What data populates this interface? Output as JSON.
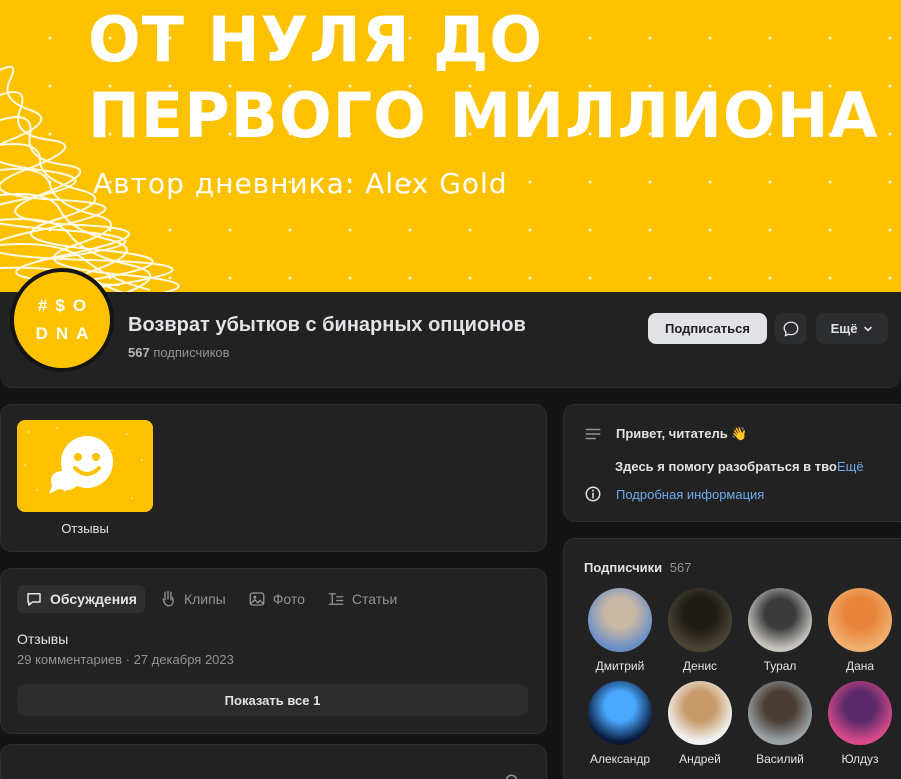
{
  "cover": {
    "title_line1": "ОТ НУЛЯ ДО",
    "title_line2": "ПЕРВОГО МИЛЛИОНА",
    "subtitle": "Автор дневника: Alex Gold",
    "color": "#fcc200"
  },
  "group": {
    "avatar_line1": "#$O",
    "avatar_line2": "DNA",
    "name": "Возврат убытков с бинарных опционов",
    "subscriber_count": "567",
    "subscriber_label": "подписчиков"
  },
  "actions": {
    "subscribe_label": "Подписаться",
    "message_icon": "message-bubble-icon",
    "more_label": "Ещё"
  },
  "album": {
    "label": "Отзывы",
    "icon": "smiley-chat-icon"
  },
  "discussions": {
    "tabs": [
      {
        "label": "Обсуждения",
        "icon": "chat-bubble-icon",
        "active": true
      },
      {
        "label": "Клипы",
        "icon": "clips-icon",
        "active": false
      },
      {
        "label": "Фото",
        "icon": "photo-icon",
        "active": false
      },
      {
        "label": "Статьи",
        "icon": "articles-icon",
        "active": false
      }
    ],
    "topic_title": "Отзывы",
    "topic_comments": "29 комментариев",
    "topic_date": "27 декабря 2023",
    "show_all_label": "Показать все 1"
  },
  "info": {
    "greeting": "Привет, читатель",
    "greeting_emoji": "👋",
    "description": "Здесь я помогу разобраться в твоей",
    "more_label": "Ещё",
    "details_link": "Подробная информация",
    "link_color": "#71aaeb"
  },
  "subscribers": {
    "title": "Подписчики",
    "count": "567",
    "members": [
      {
        "name": "Дмитрий",
        "avatar_colors": [
          "#6a8fc7",
          "#c9b8a4"
        ]
      },
      {
        "name": "Денис",
        "avatar_colors": [
          "#4a4535",
          "#1e1a14"
        ]
      },
      {
        "name": "Турал",
        "avatar_colors": [
          "#c8c5bf",
          "#3b3b3b"
        ]
      },
      {
        "name": "Дана",
        "avatar_colors": [
          "#f0b070",
          "#e8843a"
        ]
      },
      {
        "name": "Александр",
        "avatar_colors": [
          "#0a1a3a",
          "#4aa8ff"
        ]
      },
      {
        "name": "Андрей",
        "avatar_colors": [
          "#f3f3f3",
          "#c79a6a"
        ]
      },
      {
        "name": "Василий",
        "avatar_colors": [
          "#9aa3a8",
          "#4a3d33"
        ]
      },
      {
        "name": "Юлдуз",
        "avatar_colors": [
          "#d94a8a",
          "#5a2a6a"
        ]
      }
    ]
  }
}
